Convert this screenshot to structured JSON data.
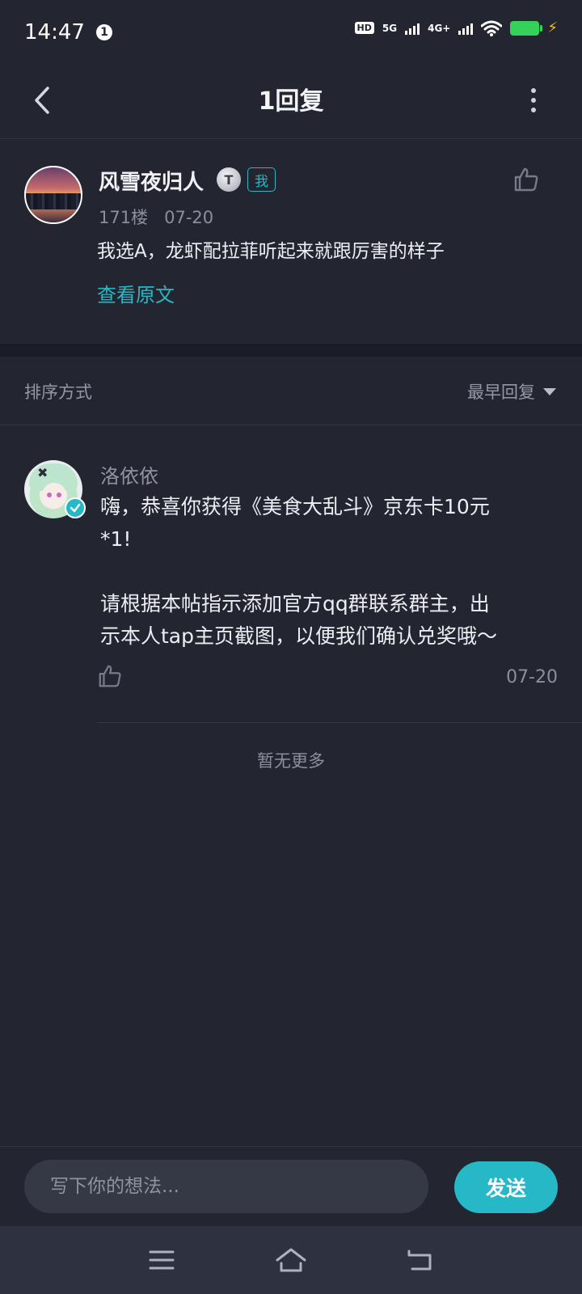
{
  "status_bar": {
    "time": "14:47",
    "notification_count": "1",
    "hd_label": "HD",
    "net1": "5G",
    "net2": "4G+"
  },
  "header": {
    "title": "1回复"
  },
  "original_comment": {
    "author": "风雪夜归人",
    "level_badge": "T",
    "me_badge": "我",
    "floor": "171楼",
    "date": "07-20",
    "text": "我选A，龙虾配拉菲听起来就跟厉害的样子",
    "view_original": "查看原文"
  },
  "sort": {
    "label": "排序方式",
    "selected": "最早回复"
  },
  "reply": {
    "author": "洛依依",
    "text_line1": "嗨，恭喜你获得《美食大乱斗》京东卡10元",
    "text_line2": "*1!",
    "text_line3": "请根据本帖指示添加官方qq群联系群主，出",
    "text_line4": "示本人tap主页截图，以便我们确认兑奖哦～",
    "date": "07-20"
  },
  "no_more": "暂无更多",
  "composer": {
    "placeholder": "写下你的想法...",
    "send_label": "发送"
  },
  "colors": {
    "background": "#232631",
    "accent": "#26b8c7",
    "battery": "#36d15b",
    "nav_bar": "#2e3240"
  }
}
